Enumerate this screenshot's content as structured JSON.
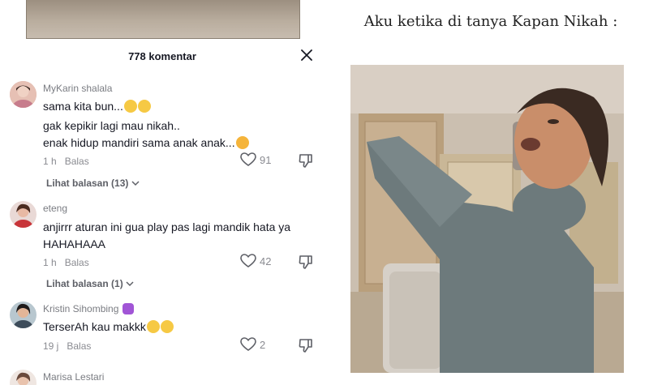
{
  "comments_sheet": {
    "count_label": "778 komentar",
    "comments": [
      {
        "username": "MyKarin shalala",
        "lines": [
          "sama kita bun...",
          "gak kepikir lagi mau nikah..",
          "enak hidup mandiri sama anak anak..."
        ],
        "time": "1 h",
        "reply_label": "Balas",
        "likes": "91",
        "view_replies": "Lihat balasan (13)"
      },
      {
        "username": "eteng",
        "lines": [
          "anjirrr aturan ini gua play pas lagi mandik hata ya",
          "HAHAHAAA"
        ],
        "time": "1 h",
        "reply_label": "Balas",
        "likes": "42",
        "view_replies": "Lihat balasan (1)"
      },
      {
        "username": "Kristin Sihombing",
        "lines": [
          "TerserAh kau makkk"
        ],
        "time": "19 j",
        "reply_label": "Balas",
        "likes": "2"
      },
      {
        "username": "Marisa Lestari"
      }
    ]
  },
  "meme": {
    "caption": "Aku ketika di tanya Kapan Nikah :"
  },
  "icons": {
    "close": "close-icon",
    "like": "heart-outline-icon",
    "dislike": "thumbs-down-outline-icon",
    "chevron": "chevron-down-icon"
  },
  "colors": {
    "text_primary": "#161823",
    "text_secondary": "#8a8b91"
  }
}
